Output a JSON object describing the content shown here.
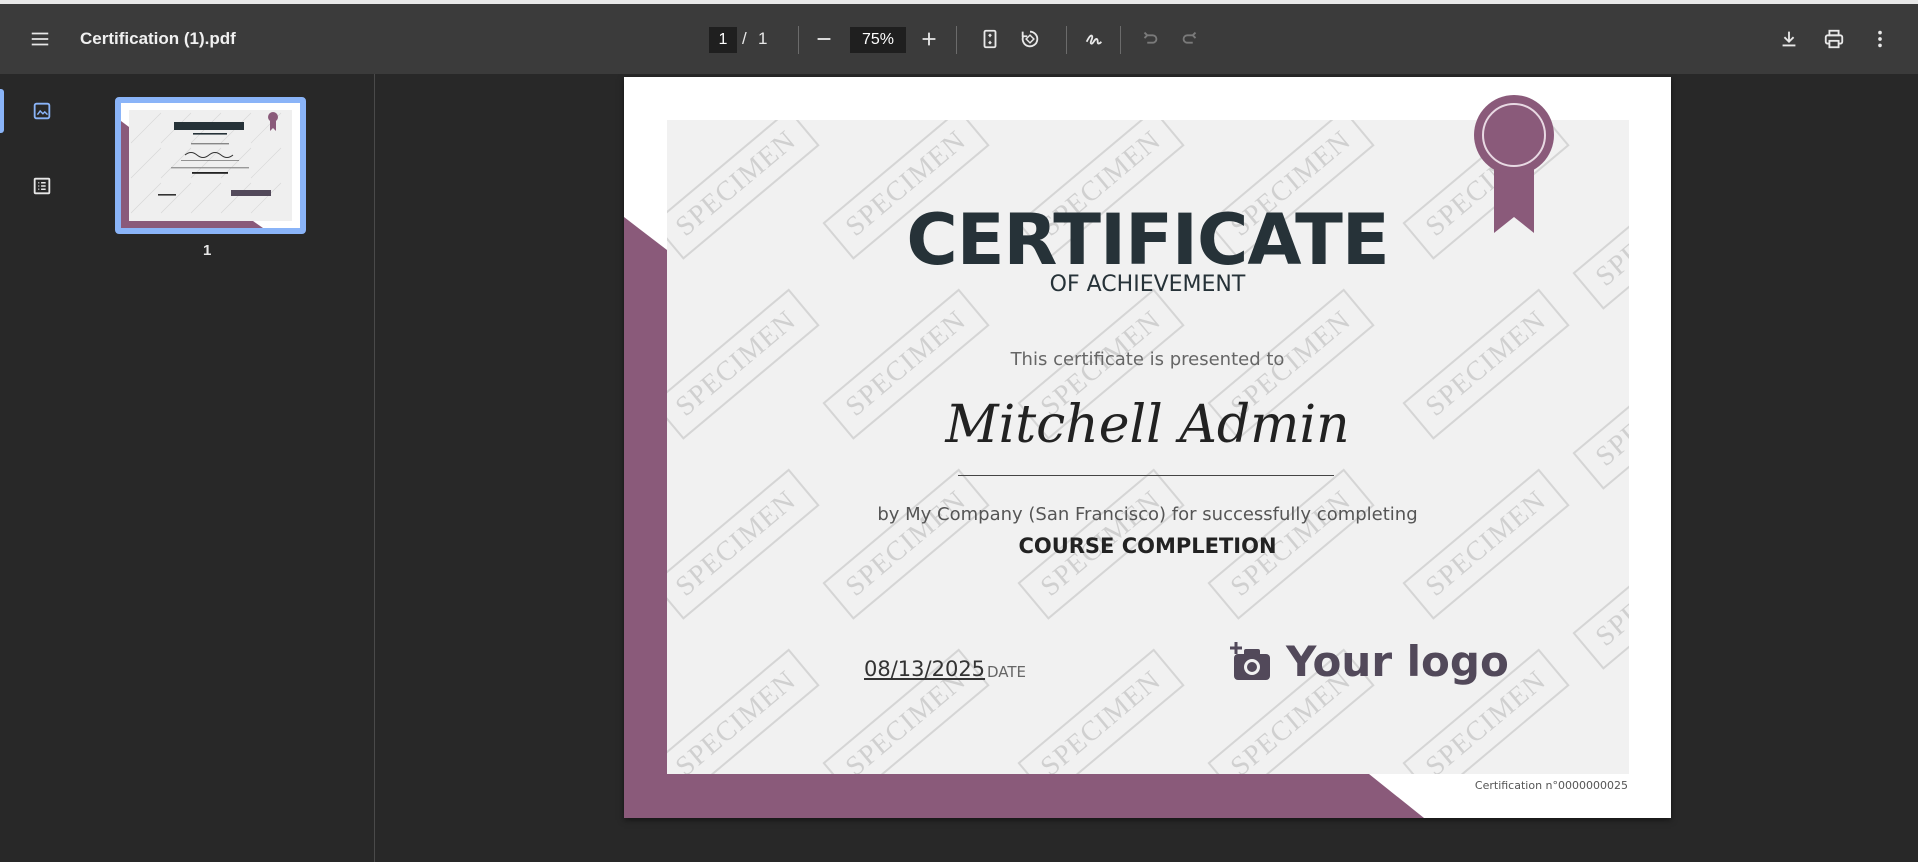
{
  "toolbar": {
    "file_name": "Certification (1).pdf",
    "current_page": "1",
    "page_separator": "/",
    "total_pages": "1",
    "zoom": "75%"
  },
  "sidebar": {
    "thumbnail_page_label": "1"
  },
  "certificate": {
    "title": "CERTIFICATE",
    "subtitle": "OF ACHIEVEMENT",
    "presented_text": "This certificate is presented to",
    "recipient": "Mitchell Admin",
    "by_text": "by My Company (San Francisco) for successfully completing",
    "course": "COURSE COMPLETION",
    "date": "08/13/2025",
    "date_label": "DATE",
    "logo_text": "Your logo",
    "watermark": "SPECIMEN",
    "certificate_number": "Certification n°0000000025"
  },
  "colors": {
    "accent": "#8a5a7a",
    "toolbar_bg": "#3b3b3b",
    "viewer_bg": "#282828",
    "selection": "#8ab4f8"
  }
}
